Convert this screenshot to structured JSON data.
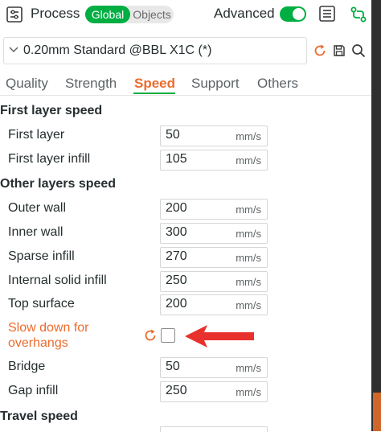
{
  "header": {
    "title": "Process",
    "scope_global": "Global",
    "scope_objects": "Objects",
    "advanced_label": "Advanced",
    "advanced_on": true
  },
  "preset": {
    "name": "0.20mm Standard @BBL X1C (*)"
  },
  "tabs": [
    "Quality",
    "Strength",
    "Speed",
    "Support",
    "Others"
  ],
  "active_tab": "Speed",
  "colors": {
    "accent_green": "#00ae42",
    "accent_orange": "#ec6b2d",
    "arrow_red": "#e8312c"
  },
  "sections": {
    "first_layer": "First layer speed",
    "other_layers": "Other layers speed",
    "travel": "Travel speed"
  },
  "settings": [
    {
      "label": "First layer",
      "value": "50",
      "unit": "mm/s"
    },
    {
      "label": "First layer infill",
      "value": "105",
      "unit": "mm/s"
    },
    {
      "label": "Outer wall",
      "value": "200",
      "unit": "mm/s"
    },
    {
      "label": "Inner wall",
      "value": "300",
      "unit": "mm/s"
    },
    {
      "label": "Sparse infill",
      "value": "270",
      "unit": "mm/s"
    },
    {
      "label": "Internal solid infill",
      "value": "250",
      "unit": "mm/s"
    },
    {
      "label": "Top surface",
      "value": "200",
      "unit": "mm/s"
    },
    {
      "label": "Bridge",
      "value": "50",
      "unit": "mm/s"
    },
    {
      "label": "Gap infill",
      "value": "250",
      "unit": "mm/s"
    }
  ],
  "overhang": {
    "label_line1": "Slow down for",
    "label_line2": "overhangs",
    "checked": false
  }
}
